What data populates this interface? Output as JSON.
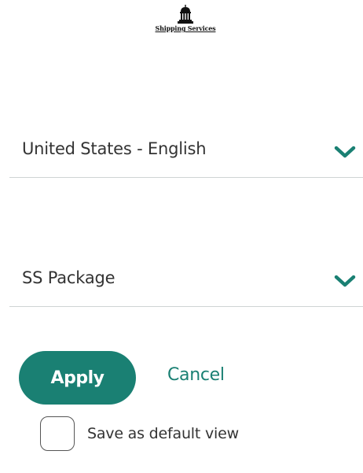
{
  "logo": {
    "text": "Shipping Services",
    "icon": "courthouse-icon"
  },
  "language_select": {
    "value": "United States - English",
    "icon": "chevron-down-icon"
  },
  "view_select": {
    "value": "SS Package",
    "icon": "chevron-down-icon"
  },
  "actions": {
    "apply_label": "Apply",
    "cancel_label": "Cancel"
  },
  "default_view": {
    "label": "Save as default view",
    "checked": false
  },
  "colors": {
    "accent": "#1a8073",
    "text": "#333333",
    "divider": "#cfd4d4"
  }
}
